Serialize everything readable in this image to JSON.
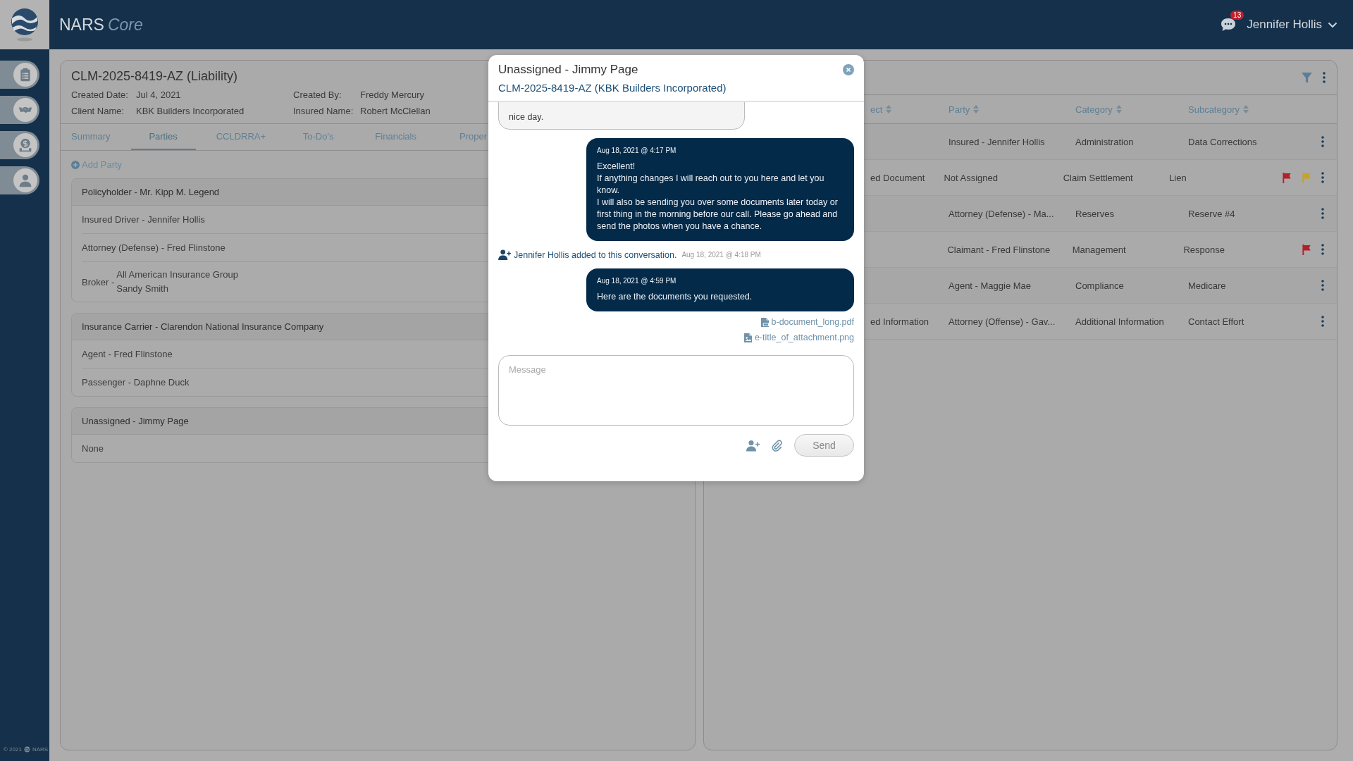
{
  "header": {
    "brand": "NARS",
    "brand_suffix": "Core",
    "notification_count": "13",
    "user": "Jennifer Hollis"
  },
  "footer": {
    "copyright": "© 2021",
    "brand": "NARS"
  },
  "claim": {
    "title": "CLM-2025-8419-AZ (Liability)",
    "details": [
      {
        "label": "Created Date:",
        "value": "Jul 4, 2021"
      },
      {
        "label": "Created By:",
        "value": "Freddy Mercury"
      },
      {
        "label": "Client Name:",
        "value": "KBK Builders Incorporated"
      },
      {
        "label": "Insured Name:",
        "value": "Robert McClellan"
      }
    ],
    "tabs": [
      {
        "label": "Summary",
        "selected": false
      },
      {
        "label": "Parties",
        "selected": true
      },
      {
        "label": "CCLDRRA+",
        "selected": false
      },
      {
        "label": "To-Do's",
        "selected": false
      },
      {
        "label": "Financials",
        "selected": false
      },
      {
        "label": "Proper",
        "selected": false
      }
    ],
    "add_party": "Add Party",
    "party_groups": [
      {
        "title": "Policyholder - Mr. Kipp M. Legend",
        "members": [
          {
            "kind": "single",
            "text": "Insured Driver - Jennifer Hollis"
          },
          {
            "kind": "single",
            "text": "Attorney (Defense) - Fred Flinstone"
          },
          {
            "kind": "multi",
            "role": "Broker -",
            "lines": [
              "All American Insurance Group",
              "Sandy Smith"
            ]
          }
        ]
      },
      {
        "title": "Insurance Carrier - Clarendon National Insurance Company",
        "members": [
          {
            "kind": "single",
            "text": "Agent - Fred Flinstone"
          },
          {
            "kind": "single",
            "text": "Passenger - Daphne Duck"
          }
        ]
      },
      {
        "title": "Unassigned - Jimmy Page",
        "members": [
          {
            "kind": "single",
            "text": "None"
          }
        ]
      }
    ]
  },
  "tasks": {
    "columns": [
      "ect",
      "Party",
      "Category",
      "Subcategory"
    ],
    "rows": [
      {
        "party": "Insured - Jennifer Hollis",
        "category": "Administration",
        "subcategory": "Data Corrections"
      },
      {
        "subject": "ed Document",
        "party": "Not Assigned",
        "category": "Claim Settlement",
        "subcategory": "Lien",
        "flags": [
          {
            "color": "#b3202a"
          },
          {
            "color": "#c9a227"
          }
        ]
      },
      {
        "party": "Attorney (Defense) - Ma...",
        "category": "Reserves",
        "subcategory": "Reserve #4"
      },
      {
        "party": "Claimant - Fred Flinstone",
        "category": "Management",
        "subcategory": "Response",
        "flags": [
          {
            "color": "#b3202a"
          }
        ]
      },
      {
        "party": "Agent - Maggie Mae",
        "category": "Compliance",
        "subcategory": "Medicare"
      },
      {
        "subject": "ed Information",
        "party": "Attorney (Offense) - Gav...",
        "category": "Additional Information",
        "subcategory": "Contact Effort"
      }
    ]
  },
  "chat": {
    "title": "Unassigned - Jimmy Page",
    "link": "CLM-2025-8419-AZ (KBK Builders Incorporated)",
    "messages": [
      {
        "kind": "incoming",
        "lines": [
          "nice day."
        ]
      },
      {
        "kind": "outgoing",
        "time": "Aug 18, 2021 @ 4:17 PM",
        "lines": [
          "Excellent!",
          "If anything changes I will reach out to you here and let you know.",
          "I will also be sending you over some documents later today or first thing in the morning before our call. Please go ahead and send the photos when you have a chance."
        ]
      },
      {
        "kind": "system",
        "text": "Jennifer Hollis added to this conversation.",
        "time": "Aug 18, 2021 @ 4:18 PM"
      },
      {
        "kind": "outgoing",
        "time": "Aug 18, 2021 @ 4:59 PM",
        "lines": [
          "Here are the documents you requested."
        ]
      },
      {
        "kind": "pdf",
        "name": "b-document_long.pdf"
      },
      {
        "kind": "image",
        "name": "e-title_of_attachment.png"
      }
    ],
    "placeholder": "Message",
    "send": {
      "label": "Send",
      "disabled": true
    }
  }
}
